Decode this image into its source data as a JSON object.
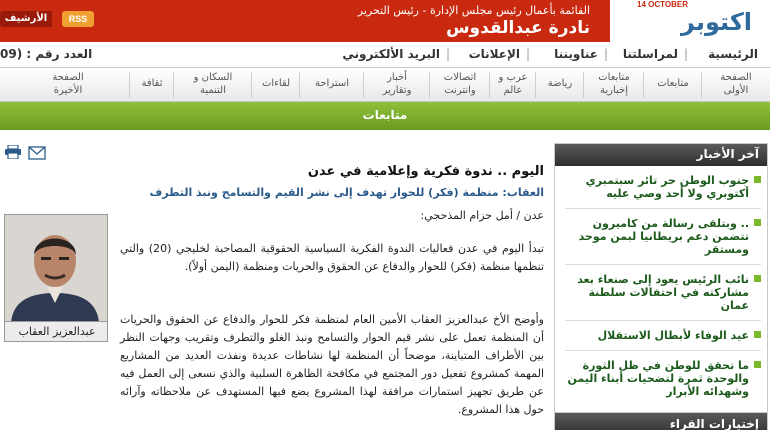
{
  "header": {
    "logo_number": "14",
    "logo_caption": "14 OCTOBER",
    "logo_arabic": "اكتوبر",
    "editor_line1": "القائمة بأعمال رئيس مجلس الإدارة - رئيس التحرير",
    "editor_line2": "نادرة عبدالقدوس",
    "rss_label": "RSS",
    "archive_label": "الأرشيف"
  },
  "toplinks": {
    "items": [
      "الرئيسية",
      "لمراسلتنا",
      "عناويننا",
      "الإعلانات",
      "البريد الألكتروني"
    ],
    "separator": "|",
    "issue_label": "العدد رقم : (09"
  },
  "nav": {
    "items": [
      [
        "الصفحة",
        "الأولى"
      ],
      [
        "متابعات",
        ""
      ],
      [
        "متابعات",
        "إخبارية"
      ],
      [
        "رياضة",
        ""
      ],
      [
        "عرب و",
        "عالم"
      ],
      [
        "اتصالات",
        "وانترنت"
      ],
      [
        "أخبار",
        "وتقارير"
      ],
      [
        "استراحة",
        ""
      ],
      [
        "لقاءات",
        ""
      ],
      [
        "السكان و",
        "التنمية"
      ],
      [
        "ثقافة",
        ""
      ],
      [
        "الصفحة",
        "الأخيرة"
      ]
    ]
  },
  "section_title": "متابعات",
  "sidebar": {
    "title": "آخر الأخبار",
    "news": [
      "جنوب الوطن حر تائر سبتمبري أكتوبري ولا أحد وصي عليه",
      ".. وبتلقى رسالة من كاميرون تتضمن دعم بريطانيا لبمن موحد ومستقر",
      "نائب الرئيس يعود إلى صنعاء بعد مشاركته في احتفالات سلطنة عمان",
      "عيد الوفاء لأبطال الاستقلال",
      "ما تحقق للوطن في ظل الثورة والوحدة ثمرة لتضحيات أبناء اليمن وشهدائه الأبرار"
    ],
    "second_title": "إختيارات القراء"
  },
  "article": {
    "title": "اليوم .. ندوة فكرية وإعلامية في عدن",
    "subtitle": "العقاب: منظمة (فكر) للحوار تهدف إلى نشر القيم والتسامح ونبذ التطرف",
    "byline": "عدن / أمل حزام المذحجي:",
    "photo_caption": "عبدالعزيز العقاب",
    "para1": "تبدأ اليوم في عدن فعاليات الندوة الفكرية السياسية الحقوقية المصاحبة لخليجي (20) والتي تنظمها منظمة (فكر) للحوار والدفاع عن الحقوق والحريات ومنظمة (اليمن أولاً).",
    "para2": "وأوضح الأخ عبدالعزيز العقاب الأمين العام لمنظمة فكر للحوار والدفاع عن الحقوق والحريات أن المنظمة تعمل على نشر قيم الحوار والتسامح ونبذ الغلو والتطرف وتقريب وجهات النظر بين الأطراف المتباينة، موضحاً أن المنظمة لها نشاطات عديدة ونفذت العديد من المشاريع المهمة كمشروع تفعيل دور المجتمع في مكافحة الظاهرة السلبية والذي نسعى إلى العمل فيه عن طريق تجهيز استمارات مرافقة لهذا المشروع يضع فيها المستهدف عن ملاحظاته وآرائه حول هذا المشروع."
  },
  "colors": {
    "header_red": "#c8290f",
    "section_green": "#7cb82c",
    "link_blue": "#2a5b8c"
  }
}
